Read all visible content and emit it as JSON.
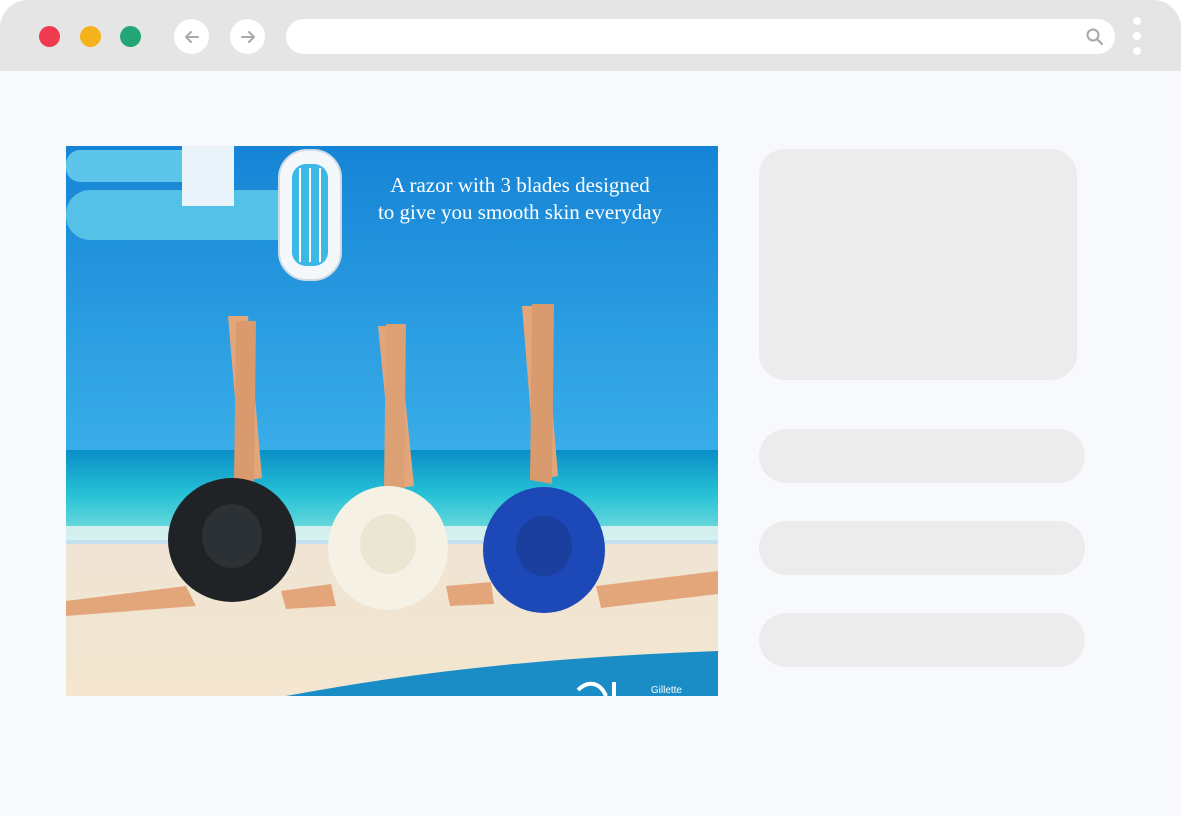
{
  "browser": {
    "url_value": "",
    "url_placeholder": "",
    "icons": {
      "back": "arrow-left-icon",
      "forward": "arrow-right-icon",
      "search": "search-icon",
      "menu": "kebab-menu-icon"
    },
    "colors": {
      "close": "#ef3a4f",
      "minimize": "#f6b21b",
      "maximize": "#22a676"
    }
  },
  "ad": {
    "headline_line1": "A razor with 3 blades designed",
    "headline_line2": "to give you smooth skin everyday",
    "brand": "Gillette"
  }
}
